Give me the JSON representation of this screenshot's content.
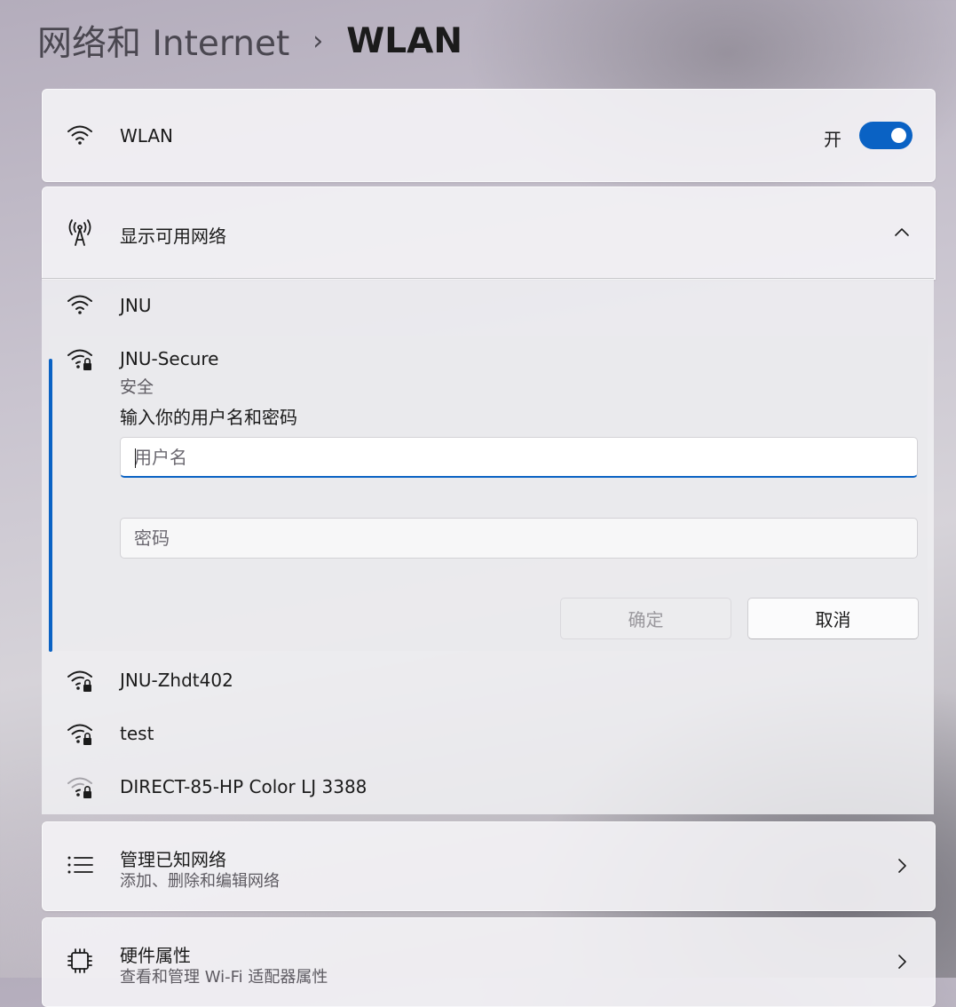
{
  "breadcrumb": {
    "parent": "网络和 Internet",
    "separator": "›",
    "current": "WLAN"
  },
  "wlan": {
    "label": "WLAN",
    "state": "开",
    "enabled": true
  },
  "available": {
    "label": "显示可用网络",
    "expanded": true
  },
  "networks": [
    {
      "name": "JNU",
      "secured": false,
      "signal": "full"
    },
    {
      "name": "JNU-Secure",
      "secured": true,
      "signal": "full",
      "status": "安全"
    },
    {
      "name": "JNU-Zhdt402",
      "secured": true,
      "signal": "full"
    },
    {
      "name": "test",
      "secured": true,
      "signal": "full"
    },
    {
      "name": "DIRECT-85-HP Color LJ 3388",
      "secured": true,
      "signal": "weak"
    }
  ],
  "login": {
    "prompt": "输入你的用户名和密码",
    "username_placeholder": "用户名",
    "username_value": "",
    "password_placeholder": "密码",
    "password_value": "",
    "ok_label": "确定",
    "cancel_label": "取消"
  },
  "manage": {
    "title": "管理已知网络",
    "subtitle": "添加、删除和编辑网络"
  },
  "hardware": {
    "title": "硬件属性",
    "subtitle": "查看和管理 Wi-Fi 适配器属性"
  },
  "colors": {
    "accent": "#0a62c4"
  }
}
